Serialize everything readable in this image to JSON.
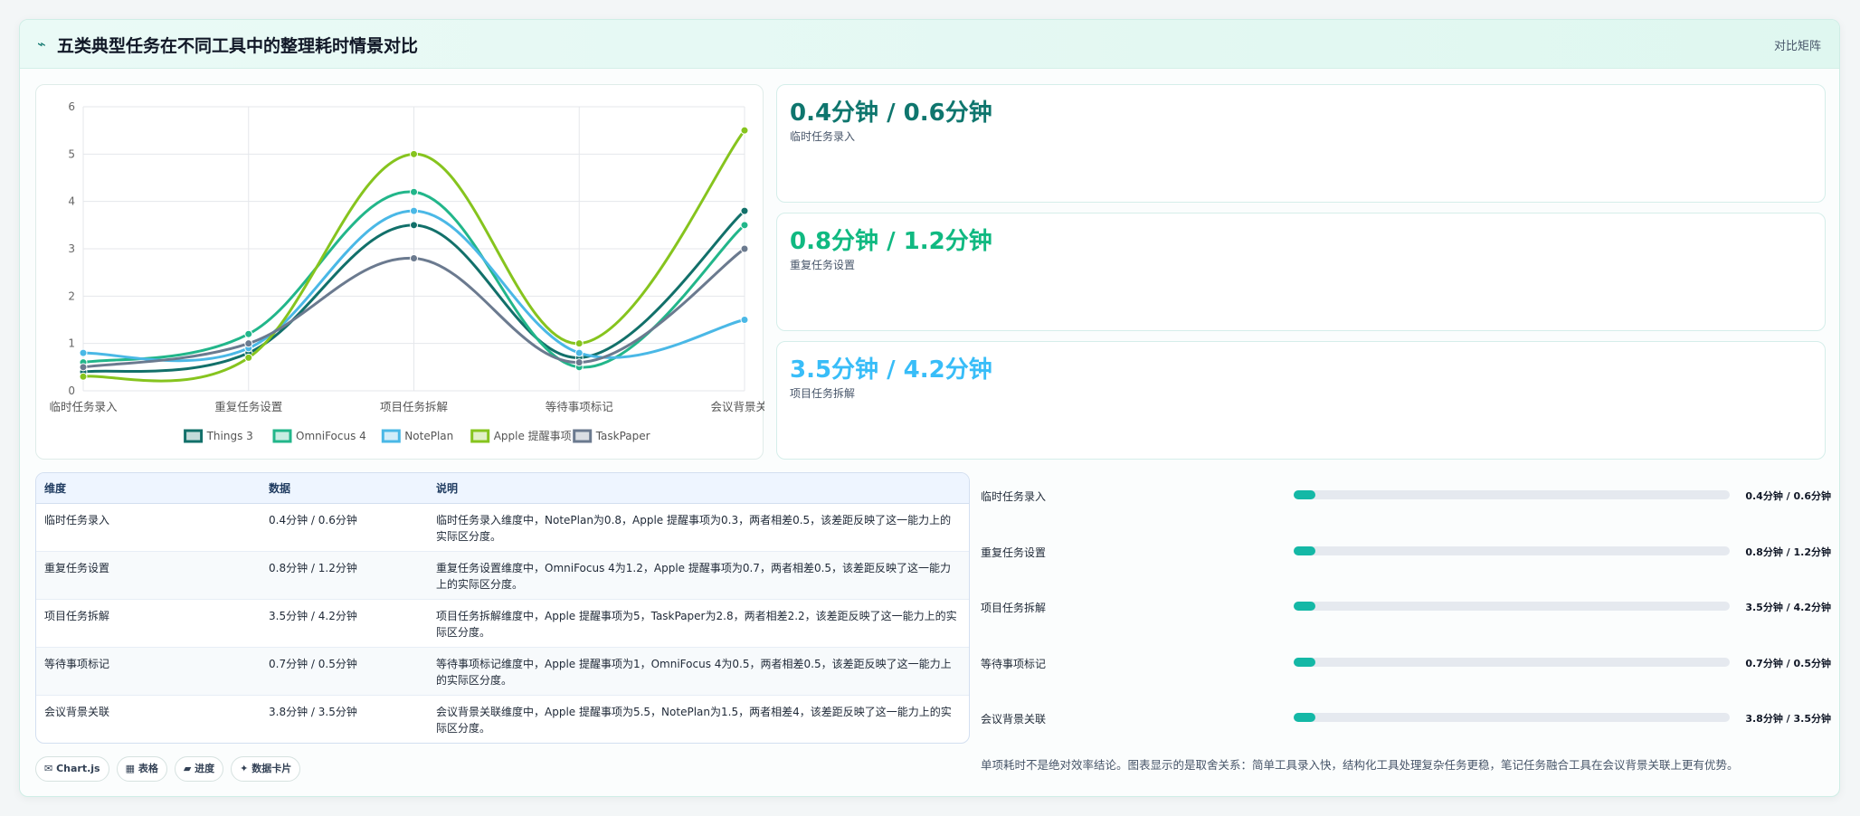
{
  "header": {
    "icon": "spark-icon",
    "title": "五类典型任务在不同工具中的整理耗时情景对比",
    "tag": "对比矩阵"
  },
  "chart_data": {
    "type": "line",
    "categories": [
      "临时任务录入",
      "重复任务设置",
      "项目任务拆解",
      "等待事项标记",
      "会议背景关联"
    ],
    "series": [
      {
        "name": "Things 3",
        "color": "#12706a",
        "values": [
          0.4,
          0.8,
          3.5,
          0.7,
          3.8
        ]
      },
      {
        "name": "OmniFocus 4",
        "color": "#22b68a",
        "values": [
          0.6,
          1.2,
          4.2,
          0.5,
          3.5
        ]
      },
      {
        "name": "NotePlan",
        "color": "#4ab8e6",
        "values": [
          0.8,
          0.9,
          3.8,
          0.8,
          1.5
        ]
      },
      {
        "name": "Apple 提醒事项",
        "color": "#86c41e",
        "values": [
          0.3,
          0.7,
          5.0,
          1.0,
          5.5
        ]
      },
      {
        "name": "TaskPaper",
        "color": "#6b7a8f",
        "values": [
          0.5,
          1.0,
          2.8,
          0.6,
          3.0
        ]
      }
    ],
    "ylim": [
      0,
      6
    ],
    "yticks": [
      "0",
      "1",
      "2",
      "3",
      "4",
      "5",
      "6"
    ],
    "grid": true,
    "legend": "bottom"
  },
  "stats": [
    {
      "value": "0.4分钟 / 0.6分钟",
      "label": "临时任务录入",
      "color": "#0f766e"
    },
    {
      "value": "0.8分钟 / 1.2分钟",
      "label": "重复任务设置",
      "color": "#10b981"
    },
    {
      "value": "3.5分钟 / 4.2分钟",
      "label": "项目任务拆解",
      "color": "#38bdf8"
    }
  ],
  "table": {
    "headers": [
      "维度",
      "数据",
      "说明"
    ],
    "rows": [
      [
        "临时任务录入",
        "0.4分钟 / 0.6分钟",
        "临时任务录入维度中，NotePlan为0.8，Apple 提醒事项为0.3，两者相差0.5，该差距反映了这一能力上的实际区分度。"
      ],
      [
        "重复任务设置",
        "0.8分钟 / 1.2分钟",
        "重复任务设置维度中，OmniFocus 4为1.2，Apple 提醒事项为0.7，两者相差0.5，该差距反映了这一能力上的实际区分度。"
      ],
      [
        "项目任务拆解",
        "3.5分钟 / 4.2分钟",
        "项目任务拆解维度中，Apple 提醒事项为5，TaskPaper为2.8，两者相差2.2，该差距反映了这一能力上的实际区分度。"
      ],
      [
        "等待事项标记",
        "0.7分钟 / 0.5分钟",
        "等待事项标记维度中，Apple 提醒事项为1，OmniFocus 4为0.5，两者相差0.5，该差距反映了这一能力上的实际区分度。"
      ],
      [
        "会议背景关联",
        "3.8分钟 / 3.5分钟",
        "会议背景关联维度中，Apple 提醒事项为5.5，NotePlan为1.5，两者相差4，该差距反映了这一能力上的实际区分度。"
      ]
    ]
  },
  "chips": [
    {
      "icon": "chart-icon",
      "glyph": "✉",
      "label": "Chart.js"
    },
    {
      "icon": "table-icon",
      "glyph": "▦",
      "label": "表格"
    },
    {
      "icon": "progress-icon",
      "glyph": "▰",
      "label": "进度"
    },
    {
      "icon": "card-icon",
      "glyph": "✦",
      "label": "数据卡片"
    }
  ],
  "progress": [
    {
      "label": "临时任务录入",
      "value": "0.4分钟 / 0.6分钟",
      "fraction": 0.05
    },
    {
      "label": "重复任务设置",
      "value": "0.8分钟 / 1.2分钟",
      "fraction": 0.05
    },
    {
      "label": "项目任务拆解",
      "value": "3.5分钟 / 4.2分钟",
      "fraction": 0.05
    },
    {
      "label": "等待事项标记",
      "value": "0.7分钟 / 0.5分钟",
      "fraction": 0.05
    },
    {
      "label": "会议背景关联",
      "value": "3.8分钟 / 3.5分钟",
      "fraction": 0.05
    }
  ],
  "note": "单项耗时不是绝对效率结论。图表显示的是取舍关系：简单工具录入快，结构化工具处理复杂任务更稳，笔记任务融合工具在会议背景关联上更有优势。"
}
